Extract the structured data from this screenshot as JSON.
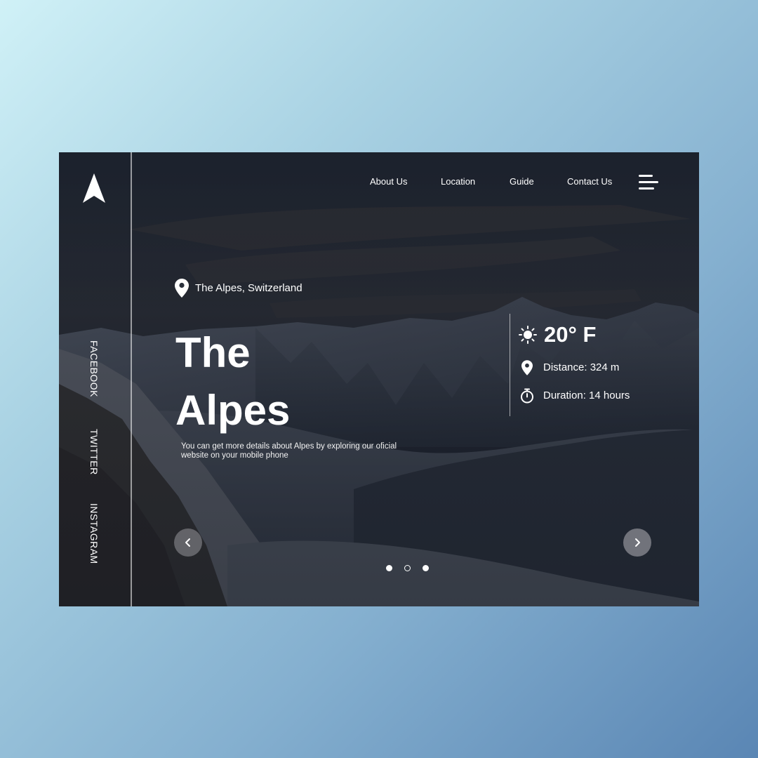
{
  "nav": {
    "items": [
      {
        "label": "About Us"
      },
      {
        "label": "Location"
      },
      {
        "label": "Guide"
      },
      {
        "label": "Contact Us"
      }
    ]
  },
  "social": {
    "items": [
      {
        "label": "FACEBOOK"
      },
      {
        "label": "TWITTER"
      },
      {
        "label": "INSTAGRAM"
      }
    ]
  },
  "hero": {
    "location": "The Alpes, Switzerland",
    "title_line1": "The",
    "title_line2": "Alpes",
    "description": "You can get more details about Alpes by exploring our oficial website on your mobile phone"
  },
  "info": {
    "temperature": "20° F",
    "distance": "Distance: 324 m",
    "duration": "Duration: 14 hours"
  },
  "icons": {
    "logo": "navigation-arrow-icon",
    "menu": "menu-icon",
    "location": "location-pin-icon",
    "weather": "sun-icon",
    "timer": "stopwatch-icon",
    "prev": "chevron-left-icon",
    "next": "chevron-right-icon"
  },
  "slider": {
    "total_slides": 3,
    "current_slide": 2
  },
  "colors": {
    "background_top": "#d0f1f7",
    "background_bottom": "#5a86b4",
    "overlay": "#1a2230",
    "text": "#ffffff"
  }
}
